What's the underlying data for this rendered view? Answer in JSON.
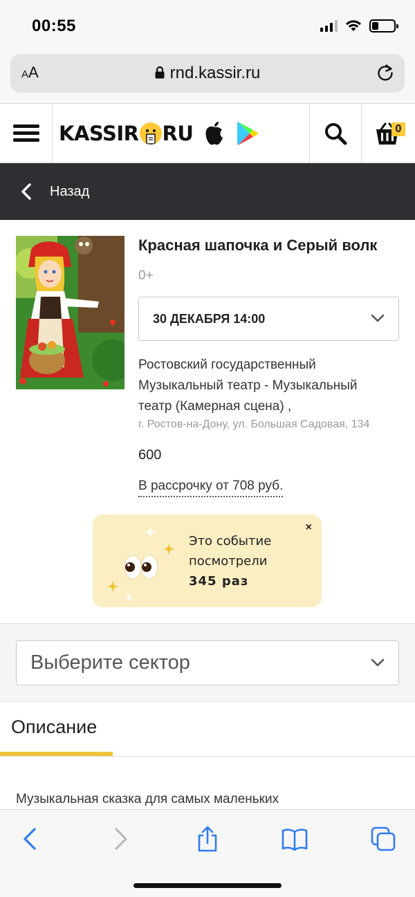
{
  "status_bar": {
    "time": "00:55",
    "icons": [
      "signal-icon",
      "wifi-icon",
      "battery-icon"
    ],
    "battery_level": 0.3
  },
  "browser": {
    "text_size_button": "AA",
    "url": "rnd.kassir.ru",
    "toolbar_icons": [
      "back-icon",
      "forward-icon",
      "share-icon",
      "bookmarks-icon",
      "tabs-icon"
    ],
    "accent_color": "#2f7cf6"
  },
  "header": {
    "logo_left": "KASSIR",
    "logo_right": "RU",
    "cart_count": "0",
    "icons": [
      "menu-icon",
      "apple-icon",
      "google-play-icon",
      "search-icon",
      "cart-icon"
    ]
  },
  "nav": {
    "back_label": "Назад"
  },
  "event": {
    "title": "Красная шапочка и Серый волк",
    "age_rating": "0+",
    "date_time": "30 ДЕКАБРЯ 14:00",
    "venue": "Ростовский государственный Музыкальный театр - Музыкальный театр (Камерная сцена) ,",
    "address": "г. Ростов-на-Дону, ул. Большая Садовая, 134",
    "price": "600",
    "installment": "В рассрочку от 708 руб."
  },
  "views_popup": {
    "line1": "Это событие",
    "line2": "посмотрели",
    "count": "345 раз",
    "close": "×"
  },
  "sector_select": {
    "placeholder": "Выберите сектор"
  },
  "tabs": {
    "description": "Описание"
  },
  "description": {
    "text": "Музыкальная сказка для самых маленьких"
  },
  "colors": {
    "brand_yellow": "#ffc837",
    "dark_bar": "#2f2f33",
    "popup_bg": "#fbeec3"
  }
}
